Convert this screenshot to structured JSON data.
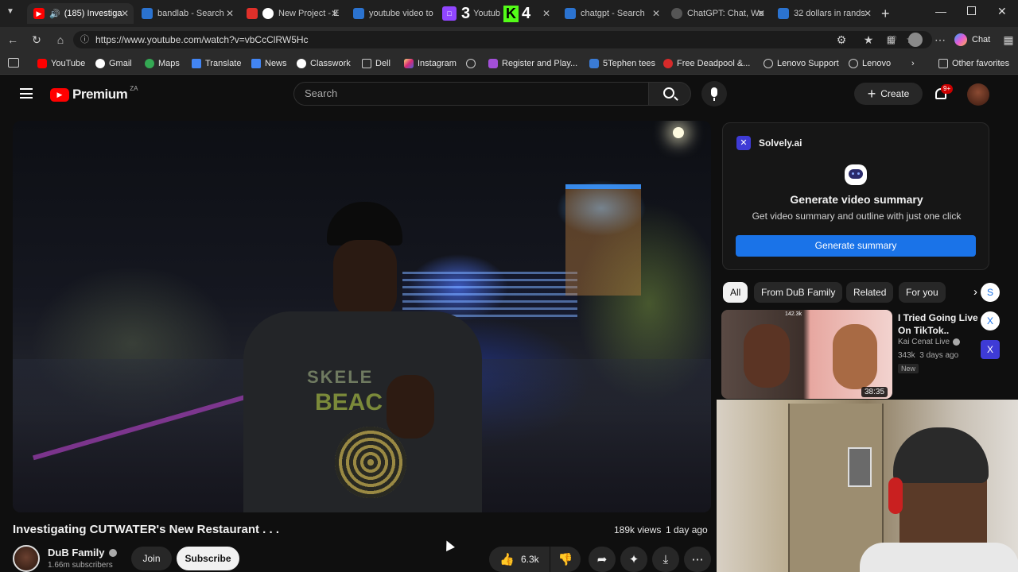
{
  "browser": {
    "tabs": [
      {
        "label": "(185) Investiga",
        "active": true
      },
      {
        "label": "bandlab - Search",
        "active": false
      },
      {
        "label": "New Project - E",
        "active": false
      },
      {
        "label": "youtube video to m",
        "active": false
      },
      {
        "label": "Youtub",
        "active": false
      },
      {
        "label": "chatgpt - Search",
        "active": false
      },
      {
        "label": "ChatGPT: Chat, Wo",
        "active": false
      },
      {
        "label": "32 dollars in rands",
        "active": false
      }
    ],
    "url": "https://www.youtube.com/watch?v=vbCcClRW5Hc",
    "chat_label": "Chat",
    "bookmarks": [
      "YouTube",
      "Gmail",
      "Maps",
      "Translate",
      "News",
      "Classwork",
      "Dell",
      "Instagram",
      "Register and Play...",
      "5Tephen tees",
      "Free Deadpool &...",
      "Lenovo Support",
      "Lenovo"
    ],
    "other_favorites": "Other favorites",
    "overlay_counts": [
      "3",
      "4"
    ]
  },
  "youtube": {
    "logo": "Premium",
    "region": "ZA",
    "search_placeholder": "Search",
    "create_label": "Create",
    "notification_count": "9+"
  },
  "solvely": {
    "brand": "Solvely.ai",
    "heading": "Generate video summary",
    "subtitle": "Get video summary and outline with just one click",
    "button": "Generate summary"
  },
  "chips": [
    "All",
    "From DuB Family",
    "Related",
    "For you"
  ],
  "recommended": {
    "title": "I Tried Going Live On TikTok..",
    "channel": "Kai Cenat Live",
    "meta": "343k  3 days ago",
    "badge": "New",
    "duration": "38:35",
    "thumb_overlay": "142.3k"
  },
  "floating_buttons": [
    "S",
    "X",
    "X"
  ],
  "video": {
    "title": "Investigating CUTWATER's New Restaurant . . .",
    "views": "189k views",
    "age": "1 day ago",
    "channel": "DuB Family",
    "subscribers": "1.66m subscribers",
    "join": "Join",
    "subscribe": "Subscribe",
    "likes": "6.3k",
    "shirt_text_1": "SKELE",
    "shirt_text_2": "BEAC"
  }
}
